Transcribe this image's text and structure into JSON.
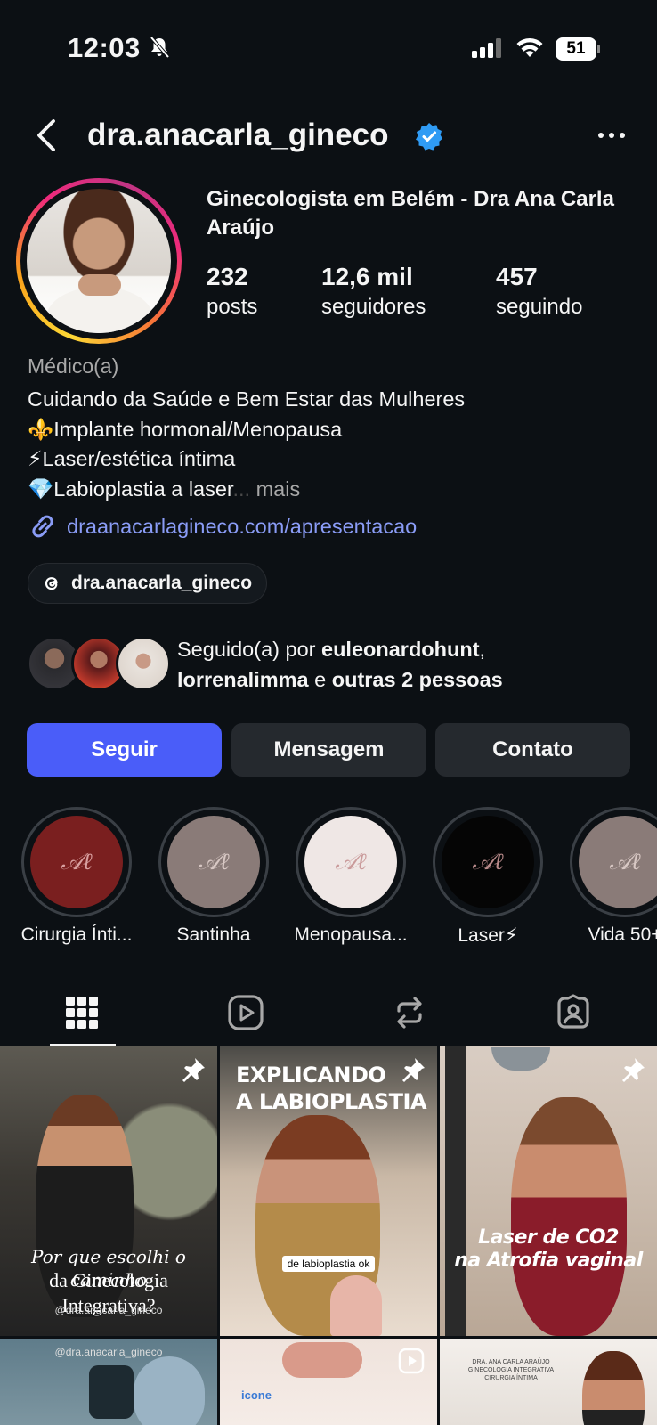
{
  "status_bar": {
    "time": "12:03",
    "battery": "51"
  },
  "header": {
    "username": "dra.anacarla_gineco"
  },
  "profile": {
    "full_name": "Ginecologista em Belém - Dra Ana Carla Araújo",
    "stats": [
      {
        "value": "232",
        "label": "posts"
      },
      {
        "value": "12,6 mil",
        "label": "seguidores"
      },
      {
        "value": "457",
        "label": "seguindo"
      }
    ],
    "category": "Médico(a)",
    "bio_lines": [
      "Cuidando da Saúde e Bem Estar das Mulheres",
      "⚜️Implante hormonal/Menopausa",
      "⚡Laser/estética íntima",
      "💎Labioplastia a laser"
    ],
    "bio_ellipsis": "...",
    "bio_more": "mais",
    "link": "draanacarlagineco.com/apresentacao",
    "threads_handle": "dra.anacarla_gineco"
  },
  "followed_by": {
    "prefix": "Seguido(a) por ",
    "user1": "euleonardohunt",
    "separator": ",",
    "user2": "lorrenalimma",
    "conj": " e ",
    "others": "outras 2 pessoas"
  },
  "actions": {
    "follow": "Seguir",
    "message": "Mensagem",
    "contact": "Contato"
  },
  "highlights": [
    {
      "label": "Cirurgia Ínti...",
      "bg": "#7a1f1f",
      "mono": "#d9a0a0"
    },
    {
      "label": "Santinha",
      "bg": "#8a7b78",
      "mono": "#d8c8c4"
    },
    {
      "label": "Menopausa...",
      "bg": "#efe7e5",
      "mono": "#c99a9a"
    },
    {
      "label": "Laser⚡",
      "bg": "#050505",
      "mono": "#b88a8a"
    },
    {
      "label": "Vida 50+",
      "bg": "#8a7b78",
      "mono": "#d8c8c4"
    }
  ],
  "tabs": [
    "grid-icon",
    "reels-icon",
    "reposts-icon",
    "tagged-icon"
  ],
  "posts": {
    "p1": {
      "caption_line1": "Por que escolhi o caminho",
      "caption_line2": "da Ginecologia Integrativa?",
      "handle": "@dra.anacarla_gineco"
    },
    "p2": {
      "headline_line1": "EXPLICANDO",
      "headline_line2": "A LABIOPLASTIA",
      "subtitle": "de labioplastia ok"
    },
    "p3": {
      "line1": "Laser de CO2",
      "line2": "na Atrofia vaginal"
    },
    "p4": {
      "handle": "@dra.anacarla_gineco"
    },
    "p5": {
      "brand": "icone"
    },
    "p6": {
      "brand_line1": "DRA. ANA CARLA ARAÚJO",
      "brand_line2": "GINECOLOGIA INTEGRATIVA",
      "brand_line3": "CIRURGIA ÍNTIMA"
    }
  }
}
